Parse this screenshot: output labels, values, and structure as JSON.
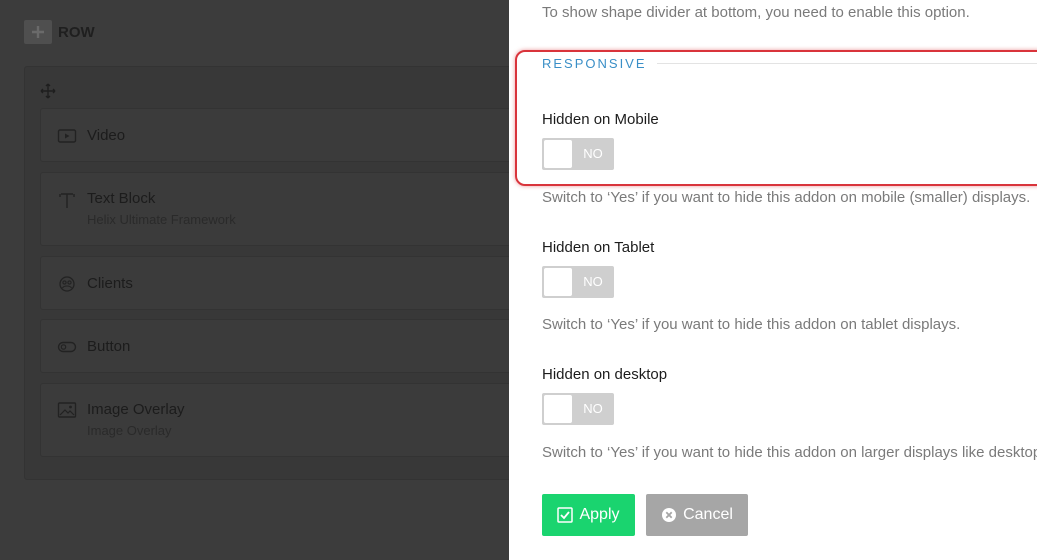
{
  "row": {
    "label": "ROW"
  },
  "addons": [
    {
      "title": "Video",
      "subtitle": "",
      "icon": "video-icon"
    },
    {
      "title": "Text Block",
      "subtitle": "Helix Ultimate Framework",
      "icon": "text-block-icon"
    },
    {
      "title": "Clients",
      "subtitle": "",
      "icon": "clients-icon"
    },
    {
      "title": "Button",
      "subtitle": "",
      "icon": "button-icon"
    },
    {
      "title": "Image Overlay",
      "subtitle": "Image Overlay",
      "icon": "image-overlay-icon"
    }
  ],
  "panel": {
    "top_help": "To show shape divider at bottom, you need to enable this option.",
    "section_title": "RESPONSIVE",
    "fields": [
      {
        "label": "Hidden on Mobile",
        "toggle": "NO",
        "help": "Switch to ‘Yes’ if you want to hide this addon on mobile (smaller) displays."
      },
      {
        "label": "Hidden on Tablet",
        "toggle": "NO",
        "help": "Switch to ‘Yes’ if you want to hide this addon on tablet displays."
      },
      {
        "label": "Hidden on desktop",
        "toggle": "NO",
        "help": "Switch to ‘Yes’ if you want to hide this addon on larger displays like desktop."
      }
    ],
    "apply_label": "Apply",
    "cancel_label": "Cancel"
  },
  "colors": {
    "accent": "#3a8fc7",
    "apply": "#1ad46f",
    "cancel": "#a6a6a6",
    "highlight": "#d9343b",
    "toggle_off": "#cfcfcf"
  }
}
